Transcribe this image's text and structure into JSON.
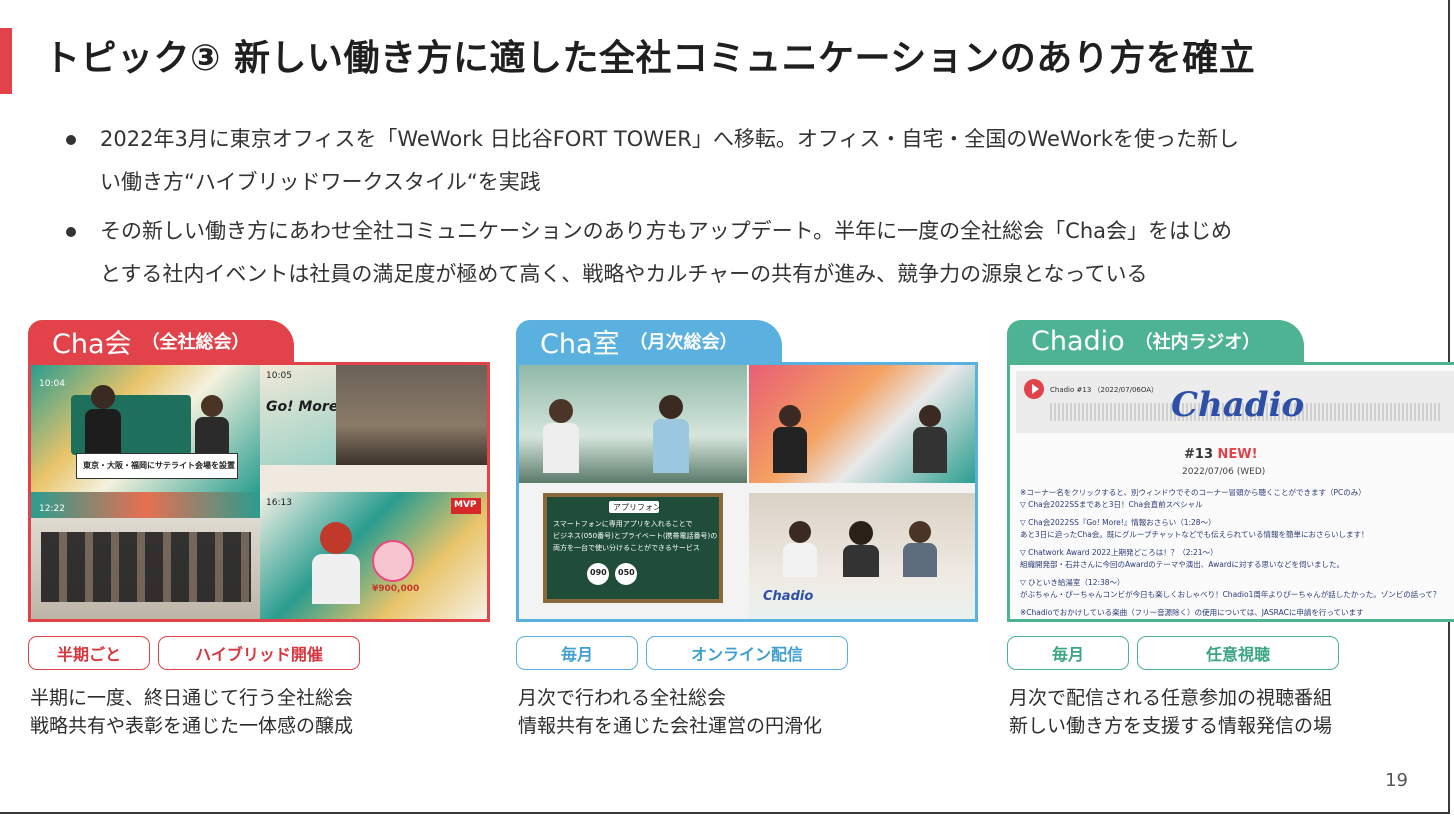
{
  "title": "トピック③ 新しい働き方に適した全社コミュニケーションのあり方を確立",
  "bullets": [
    {
      "line1": "2022年3月に東京オフィスを「WeWork 日比谷FORT TOWER」へ移転。オフィス・自宅・全国のWeWorkを使った新し",
      "line2": "い働き方“ハイブリッドワークスタイル“を実践"
    },
    {
      "line1": "その新しい働き方にあわせ全社コミュニケーションのあり方もアップデート。半年に一度の全社総会「Cha会」をはじめ",
      "line2": "とする社内イベントは社員の満足度が極めて高く、戦略やカルチャーの共有が進み、競争力の源泉となっている"
    }
  ],
  "cards": [
    {
      "name": "Cha会",
      "sub": "（全社総会）",
      "tags": [
        "半期ごと",
        "ハイブリッド開催"
      ],
      "desc": [
        "半期に一度、終日通じて行う全社総会",
        "戦略共有や表彰を通じた一体感の醸成"
      ],
      "photo": {
        "live_a": "Go! More!",
        "caption_a": "東京・大阪・福岡にサテライト会場を設置",
        "badge": "MVP",
        "count": "¥900,000",
        "time_a": "10:04",
        "time_b": "10:05",
        "time_c": "12:22",
        "time_d": "16:13"
      }
    },
    {
      "name": "Cha室",
      "sub": "（月次総会）",
      "tags": [
        "毎月",
        "オンライン配信"
      ],
      "desc": [
        "月次で行われる全社総会",
        "情報共有を通じた会社運営の円滑化"
      ],
      "photo": {
        "board_title": "アプリフォン",
        "board_l1": "スマートフォンに専用アプリを入れることで",
        "board_l2": "ビジネス(050番号)とプライベート(携帯電話番号)の",
        "board_l3": "両方を一台で使い分けることができるサービス",
        "num_a": "090",
        "num_b": "050",
        "chadio_mark": "Chadio"
      }
    },
    {
      "name": "Chadio",
      "sub": "（社内ラジオ）",
      "tags": [
        "毎月",
        "任意視聴"
      ],
      "desc": [
        "月次で配信される任意参加の視聴番組",
        "新しい働き方を支援する情報発信の場"
      ],
      "photo": {
        "player_title": "Chadio #13 （2022/07/06OA）",
        "logo": "Chadio",
        "episode": "#13",
        "new_label": "NEW!",
        "date": "2022/07/06 (WED)",
        "lines": [
          "※コーナー名をクリックすると、別ウィンドウでそのコーナー冒頭から聴くことができます（PCのみ）",
          "▽ Cha会2022SSまであと3日！Cha会直前スペシャル",
          "▽ Cha会2022SS『Go! More!』情報おさらい（1:28〜）",
          "あと3日に迫ったCha会。既にグループチャットなどでも伝えられている情報を簡単におさらいします！",
          "▽ Chatwork Award 2022上期発どころは！？（2:21〜）",
          "組織開発部・石井さんに今回のAwardのテーマや演出、Awardに対する思いなどを伺いました。",
          "▽ ひといき給湯室（12:38〜）",
          "がぶちゃん・ぴーちゃんコンビが今日も楽しくおしゃべり！Chadio1周年よりぴーちゃんが話したかった。ゾンビの話って？",
          "※Chadioでおかけしている楽曲（フリー音源除く）の使用については、JASRACに申請を行っています"
        ]
      }
    }
  ],
  "page_number": "19"
}
